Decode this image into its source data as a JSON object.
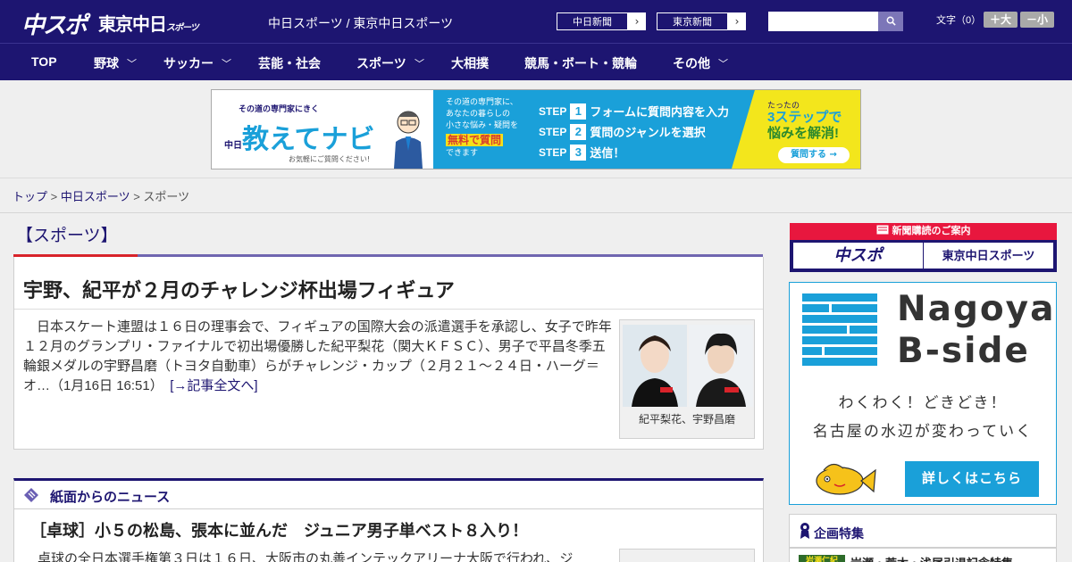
{
  "header": {
    "logo_main": "中スポ",
    "logo_tokyo": "東京中日",
    "logo_tokyo_small": "スポーツ",
    "site_title": "中日スポーツ / 東京中日スポーツ",
    "paper_links": [
      "中日新聞",
      "東京新聞"
    ],
    "search_placeholder": "",
    "font_size_label": "文字（0）",
    "font_bigger": "＋大",
    "font_smaller": "－小"
  },
  "nav": {
    "items": [
      {
        "label": "TOP",
        "has_menu": false
      },
      {
        "label": "野球",
        "has_menu": true
      },
      {
        "label": "サッカー",
        "has_menu": true
      },
      {
        "label": "芸能・社会",
        "has_menu": false
      },
      {
        "label": "スポーツ",
        "has_menu": true
      },
      {
        "label": "大相撲",
        "has_menu": false
      },
      {
        "label": "競馬・ボート・競輪",
        "has_menu": false
      },
      {
        "label": "その他",
        "has_menu": true
      }
    ]
  },
  "ad_banner": {
    "tagline": "その道の専門家にきく",
    "brand_prefix": "中日",
    "brand": "教えてナビ",
    "note": "お気軽にご質問ください!",
    "desc": [
      "その道の専門家に、",
      "あなたの暮らしの",
      "小さな悩み・疑問を"
    ],
    "free": "無料で質問",
    "free_suffix": "できます",
    "steps": [
      {
        "label": "STEP",
        "num": "1",
        "text": "フォームに質問内容を入力"
      },
      {
        "label": "STEP",
        "num": "2",
        "text": "質問のジャンルを選択"
      },
      {
        "label": "STEP",
        "num": "3",
        "text": "送信！"
      }
    ],
    "tatta": "たったの",
    "headline1": "3ステップで",
    "headline2": "悩みを解消!",
    "cta": "質問する →"
  },
  "breadcrumb": {
    "items": [
      "トップ",
      "中日スポーツ",
      "スポーツ"
    ],
    "separator": " > "
  },
  "main": {
    "category": "【スポーツ】",
    "article": {
      "title": "宇野、紀平が２月のチャレンジ杯出場フィギュア",
      "body": "日本スケート連盟は１６日の理事会で、フィギュアの国際大会の派遣選手を承認し、女子で昨年１２月のグランプリ・ファイナルで初出場優勝した紀平梨花（関大ＫＦＳＣ）、男子で平昌冬季五輪銀メダルの宇野昌磨（トヨタ自動車）らがチャレンジ・カップ（２月２１～２４日・ハーグ＝オ…（1月16日 16:51）　",
      "more": "[→記事全文へ]",
      "photo_caption": "紀平梨花、宇野昌磨"
    },
    "news_section": {
      "title": "紙面からのニュース",
      "headline": "［卓球］小５の松島、張本に並んだ　ジュニア男子単ベスト８入り！",
      "lead": "卓球の全日本選手権第３日は１６日、大阪市の丸善インテックアリーナ大阪で行われ、ジ"
    }
  },
  "sidebar": {
    "subscribe_header": "新聞購読のご案内",
    "subscribe_logos": [
      "中スポ",
      "東京中日スポーツ"
    ],
    "bside": {
      "name_line1": "Nagoya",
      "name_line2": "B-side",
      "sub1": "わくわく！どきどき！",
      "sub2": "名古屋の水辺が変わっていく",
      "button": "詳しくはこちら"
    },
    "feature": {
      "title": "企画特集",
      "item_tag": "岩瀬仁紀",
      "item_text": "岩瀬・荒木・浅尾引退記念特集"
    }
  },
  "colors": {
    "brand_navy": "#1d1571",
    "accent_red": "#d8232a",
    "accent_blue": "#1aa0d9",
    "ad_yellow": "#f3e61c"
  }
}
